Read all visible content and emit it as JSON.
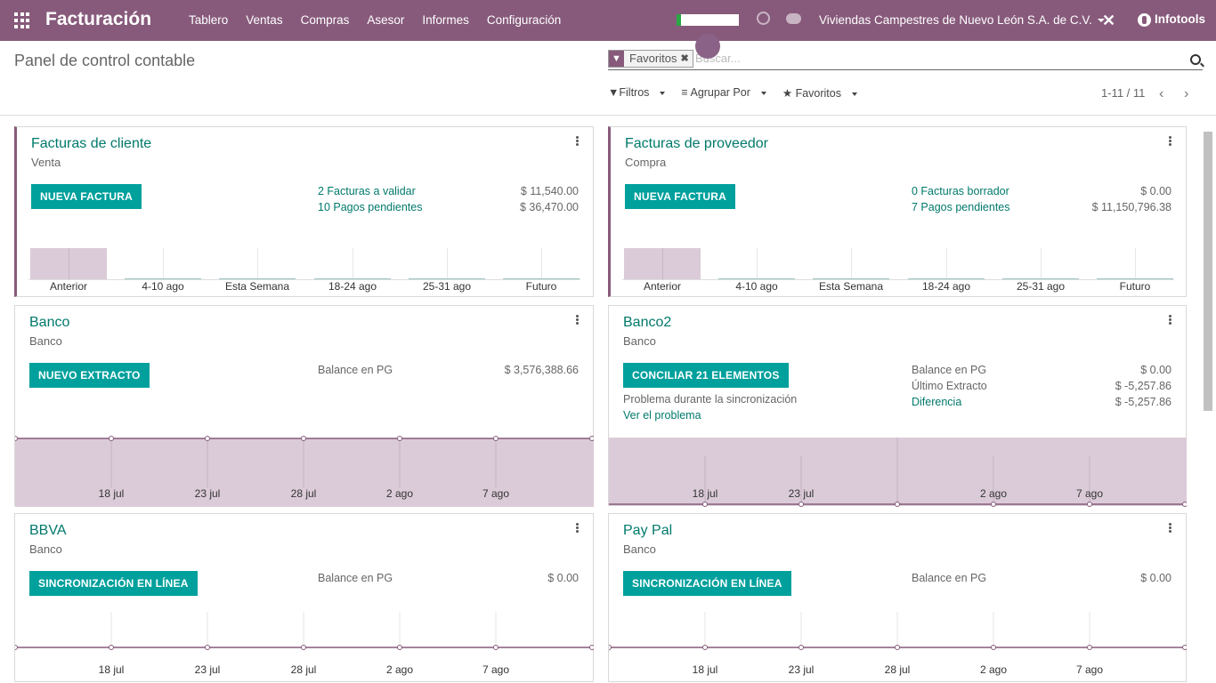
{
  "nav": {
    "app_title": "Facturación",
    "menu": [
      "Tablero",
      "Ventas",
      "Compras",
      "Asesor",
      "Informes",
      "Configuración"
    ],
    "company": "Viviendas Campestres de Nuevo León S.A. de C.V.",
    "user": "Infotools",
    "bg_color": "#875a7b"
  },
  "control": {
    "title": "Panel de control contable",
    "facet": "Favoritos",
    "search_placeholder": "Buscar...",
    "filters": "Filtros",
    "group_by": "Agrupar Por",
    "favorites": "Favoritos",
    "pager": "1-11 / 11"
  },
  "cards": {
    "sales": {
      "name": "Facturas de cliente",
      "type": "Venta",
      "button": "NUEVA FACTURA",
      "line1_label": "2 Facturas a validar",
      "line1_amount": "$ 11,540.00",
      "line2_label": "10 Pagos pendientes",
      "line2_amount": "$ 36,470.00",
      "x": [
        "Anterior",
        "4-10 ago",
        "Esta Semana",
        "18-24 ago",
        "25-31 ago",
        "Futuro"
      ]
    },
    "purchase": {
      "name": "Facturas de proveedor",
      "type": "Compra",
      "button": "NUEVA FACTURA",
      "line1_label": "0 Facturas borrador",
      "line1_amount": "$ 0.00",
      "line2_label": "7 Pagos pendientes",
      "line2_amount": "$ 11,150,796.38",
      "x": [
        "Anterior",
        "4-10 ago",
        "Esta Semana",
        "18-24 ago",
        "25-31 ago",
        "Futuro"
      ]
    },
    "banco": {
      "name": "Banco",
      "type": "Banco",
      "button": "NUEVO EXTRACTO",
      "balance_label": "Balance en PG",
      "balance_amount": "$ 3,576,388.66",
      "x": [
        "18 jul",
        "23 jul",
        "28 jul",
        "2 ago",
        "7 ago"
      ]
    },
    "banco2": {
      "name": "Banco2",
      "type": "Banco",
      "button": "CONCILIAR 21 ELEMENTOS",
      "sync_error": "Problema durante la sincronización",
      "see_problem": "Ver el problema",
      "balance_label": "Balance en PG",
      "balance_amount": "$ 0.00",
      "last_label": "Último Extracto",
      "last_amount": "$ -5,257.86",
      "diff_label": "Diferencia",
      "diff_amount": "$ -5,257.86",
      "x": [
        "18 jul",
        "23 jul",
        "2 ago",
        "7 ago"
      ]
    },
    "bbva": {
      "name": "BBVA",
      "type": "Banco",
      "button": "SINCRONIZACIÓN EN LÍNEA",
      "balance_label": "Balance en PG",
      "balance_amount": "$ 0.00",
      "x": [
        "18 jul",
        "23 jul",
        "28 jul",
        "2 ago",
        "7 ago"
      ]
    },
    "paypal": {
      "name": "Pay Pal",
      "type": "Banco",
      "button": "SINCRONIZACIÓN EN LÍNEA",
      "balance_label": "Balance en PG",
      "balance_amount": "$ 0.00",
      "x": [
        "18 jul",
        "23 jul",
        "28 jul",
        "2 ago",
        "7 ago"
      ]
    }
  }
}
